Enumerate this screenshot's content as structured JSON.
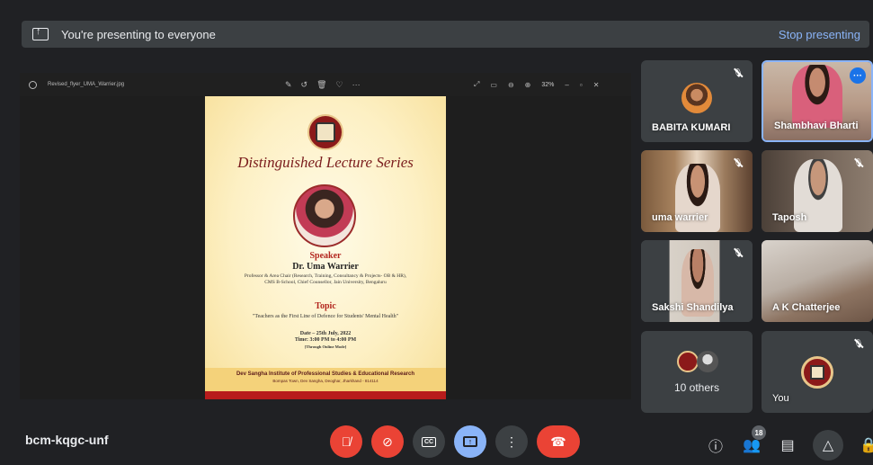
{
  "banner": {
    "text": "You're presenting to everyone",
    "stop_label": "Stop presenting"
  },
  "viewer": {
    "filename": "Revised_flyer_UMA_Warrier.jpg",
    "zoom": "32%"
  },
  "poster": {
    "series_title": "Distinguished Lecture Series",
    "speaker_heading": "Speaker",
    "speaker_name": "Dr. Uma Warrier",
    "speaker_desc": "Professor & Area Chair (Research, Training, Consultancy & Projects- OB & HR), CMS B-School, Chief Counsellor, Jain University, Bengaluru",
    "topic_heading": "Topic",
    "topic": "\"Teachers as the First Line of Defence for Students' Mental Health\"",
    "date": "Date – 25th July, 2022",
    "time": "Time: 3:00 PM to 4:00 PM",
    "mode": "[Through Online Mode]",
    "institute": "Dev Sangha Institute of Professional Studies & Educational Research",
    "address": "Bompas Town, Dev Sangha, Deoghar, Jharkhand - 814114"
  },
  "participants": [
    {
      "name": "BABITA KUMARI",
      "muted": true
    },
    {
      "name": "Shambhavi Bharti",
      "muted": false
    },
    {
      "name": "uma warrier",
      "muted": true
    },
    {
      "name": "Taposh",
      "muted": true
    },
    {
      "name": "Sakshi Shandilya",
      "muted": true
    },
    {
      "name": "A K Chatterjee",
      "muted": false
    },
    {
      "name": "10 others"
    },
    {
      "name": "You",
      "muted": true
    }
  ],
  "meeting_code": "bcm-kqgc-unf",
  "participant_count": "18",
  "colors": {
    "accent": "#8ab4f8",
    "danger": "#ea4335",
    "surface": "#3c4043",
    "background": "#202124"
  }
}
